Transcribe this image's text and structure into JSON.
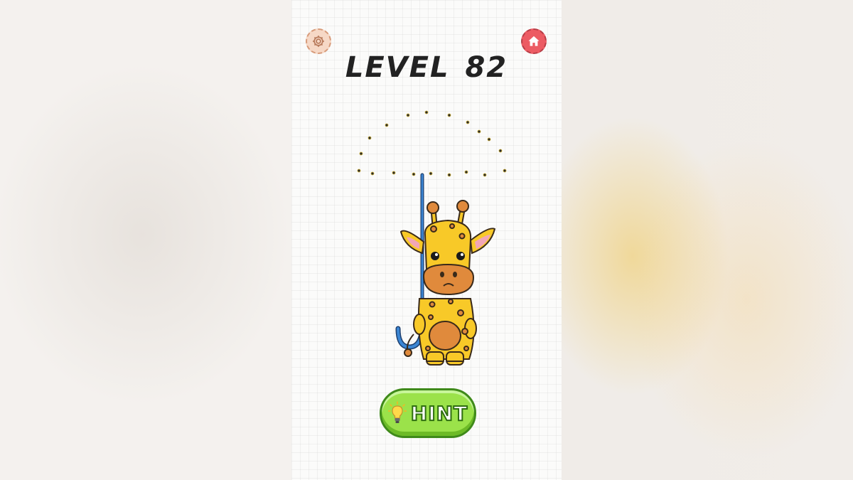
{
  "level": {
    "label": "LEVEL",
    "number": "82"
  },
  "buttons": {
    "settings_icon": "gear-icon",
    "home_icon": "home-icon",
    "hint_label": "HINT",
    "hint_icon": "lightbulb-icon"
  },
  "colors": {
    "hint_green": "#9be24a",
    "home_red": "#ec5b63",
    "settings_peach": "#f6d8c6",
    "giraffe_yellow": "#f8c928",
    "giraffe_spots": "#e08a3c",
    "umbrella_handle": "#2f6fb6"
  },
  "scene": {
    "character": "giraffe",
    "object": "umbrella-handle",
    "dotted_guide": "umbrella-canopy-outline"
  }
}
